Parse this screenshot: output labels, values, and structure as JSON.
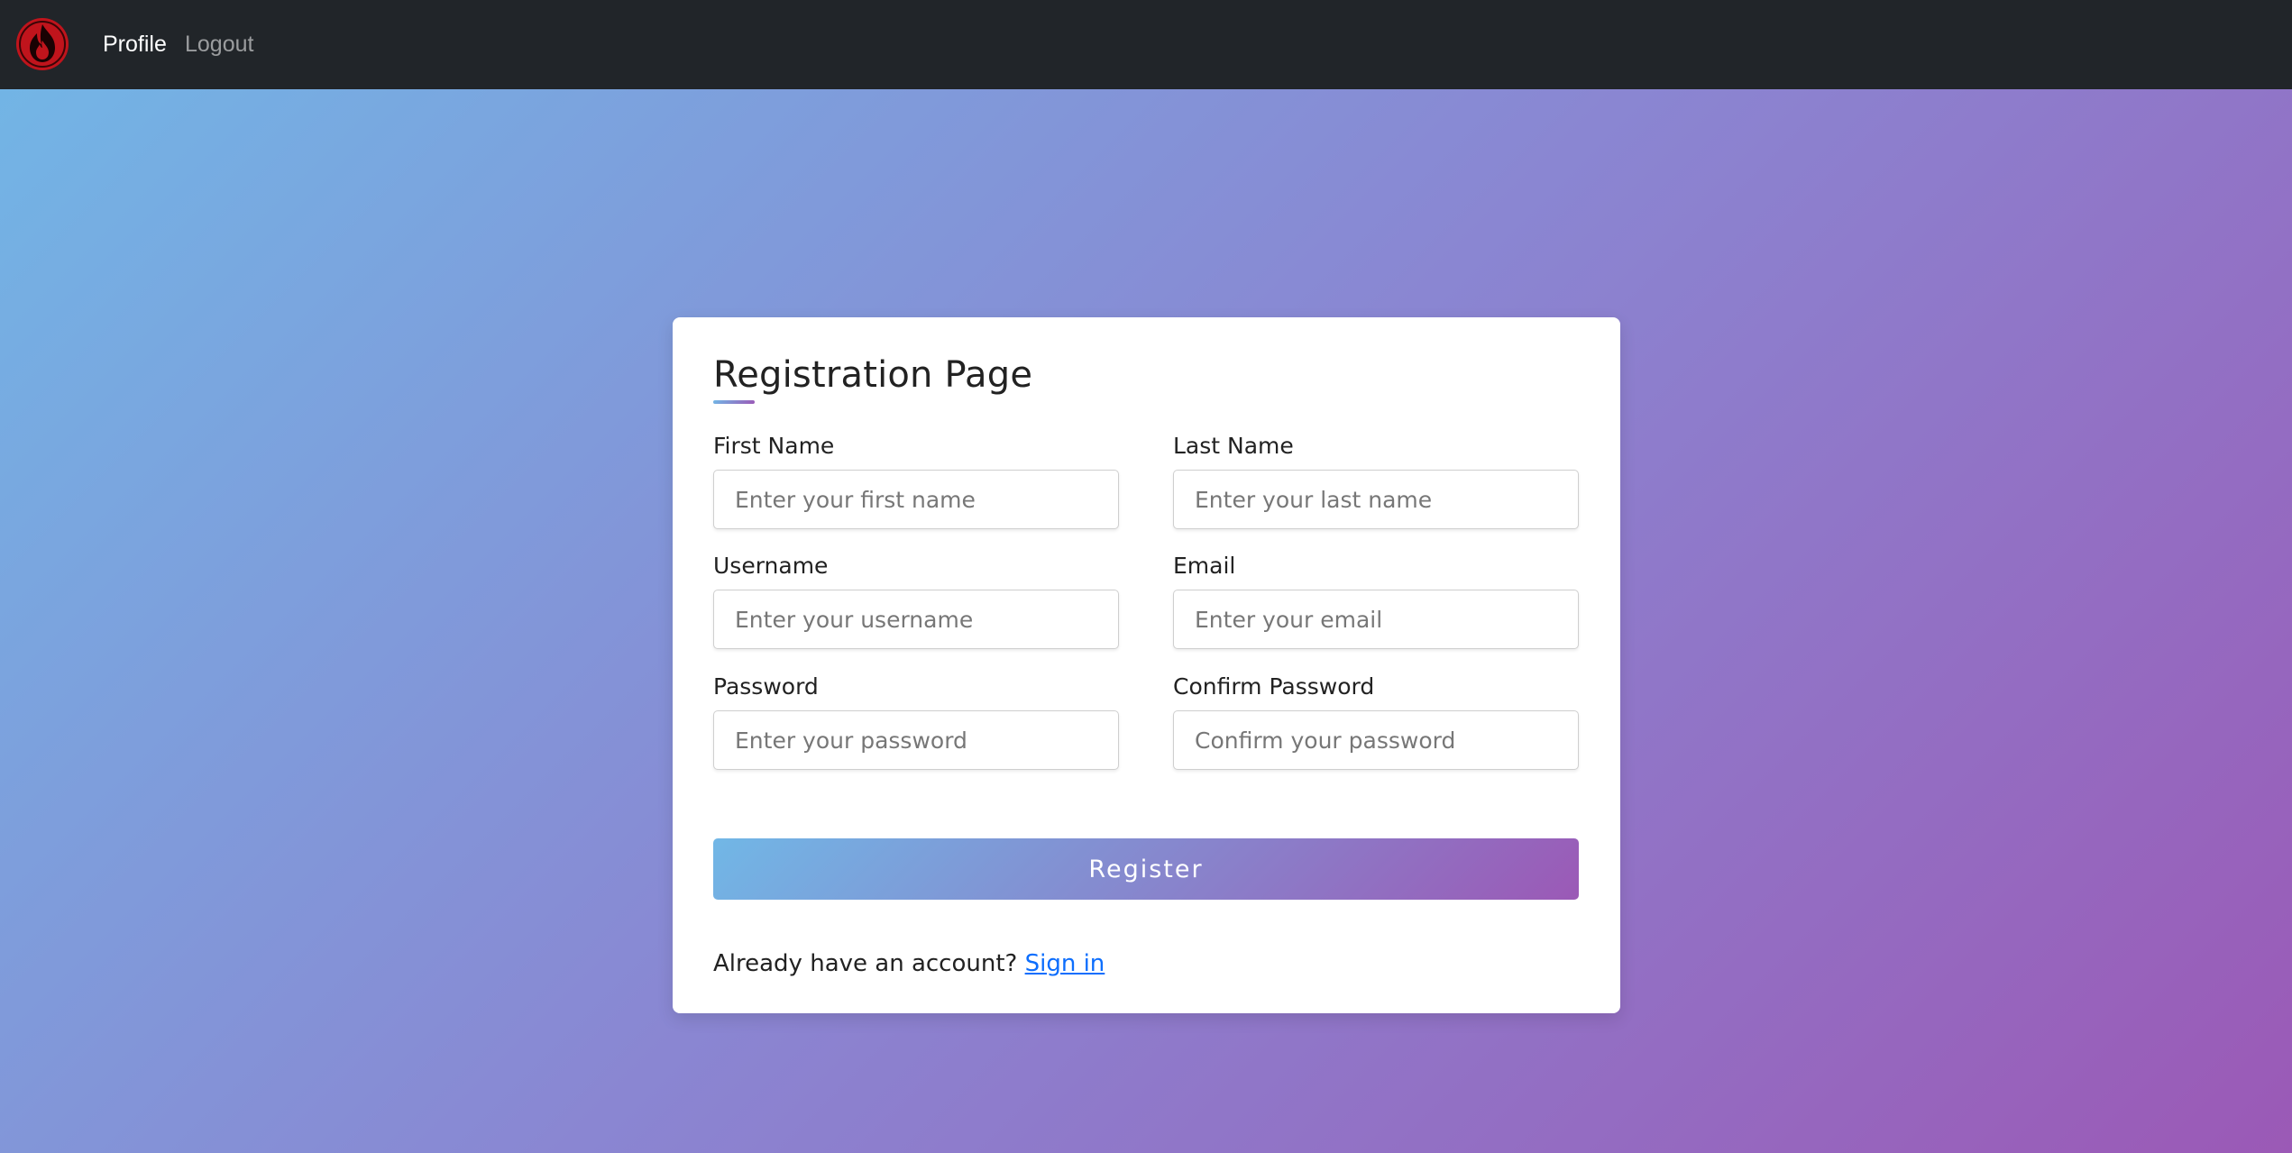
{
  "navbar": {
    "brand_icon": "fire-nation-emblem-icon",
    "brand_color": "#c0141c",
    "links": [
      {
        "label": "Profile",
        "active": true
      },
      {
        "label": "Logout",
        "active": false
      }
    ]
  },
  "form": {
    "title": "Registration Page",
    "fields": {
      "first_name": {
        "label": "First Name",
        "placeholder": "Enter your first name",
        "value": ""
      },
      "last_name": {
        "label": "Last Name",
        "placeholder": "Enter your last name",
        "value": ""
      },
      "username": {
        "label": "Username",
        "placeholder": "Enter your username",
        "value": ""
      },
      "email": {
        "label": "Email",
        "placeholder": "Enter your email",
        "value": ""
      },
      "password": {
        "label": "Password",
        "placeholder": "Enter your password",
        "value": ""
      },
      "confirm_password": {
        "label": "Confirm Password",
        "placeholder": "Confirm your password",
        "value": ""
      }
    },
    "submit_label": "Register",
    "signin_prompt": "Already have an account?",
    "signin_link": "Sign in"
  },
  "colors": {
    "navbar_bg": "#212529",
    "gradient_start": "#71b7e6",
    "gradient_end": "#9b59b6",
    "link": "#0d6efd"
  }
}
